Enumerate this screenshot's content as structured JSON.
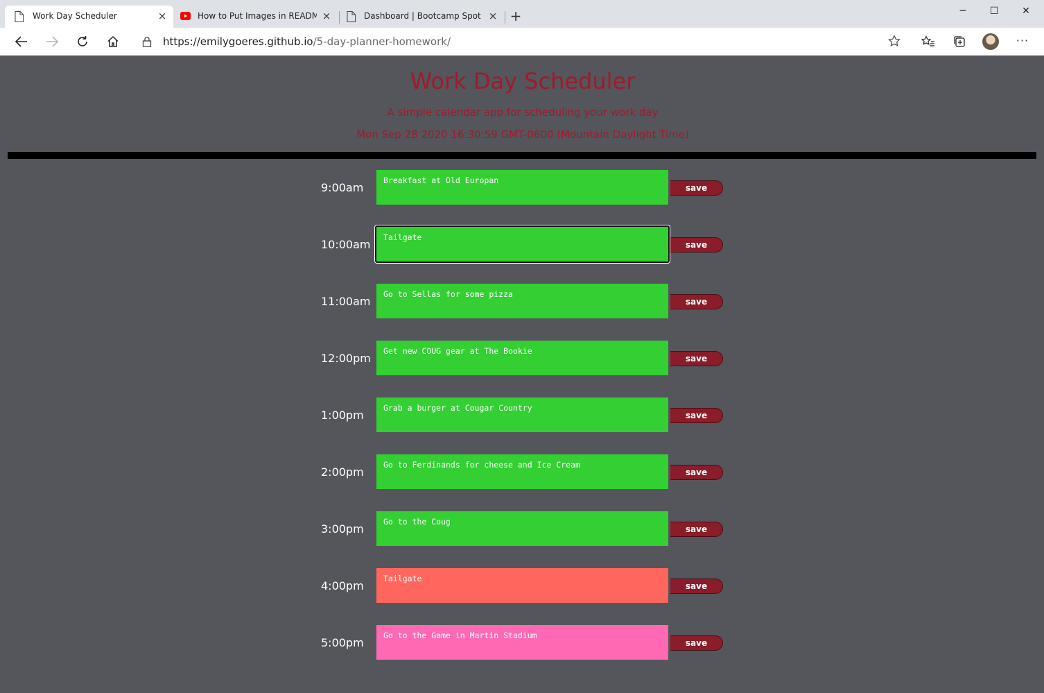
{
  "browser": {
    "tabs": [
      {
        "title": "Work Day Scheduler",
        "icon": "page-icon"
      },
      {
        "title": "How to Put Images in README f",
        "icon": "youtube-icon"
      },
      {
        "title": "Dashboard | Bootcamp Spot",
        "icon": "page-icon"
      }
    ],
    "close_glyph": "×",
    "new_tab_glyph": "+",
    "url_host": "https://emilygoeres.github.io",
    "url_path": "/5-day-planner-homework/",
    "window_controls": {
      "minimize": "─",
      "maximize": "☐",
      "close": "✕"
    },
    "more_glyph": "···"
  },
  "header": {
    "title": "Work Day Scheduler",
    "lead": "A simple calendar app for scheduling your work day",
    "current_day": "Mon Sep 28 2020 16:30:59 GMT-0600 (Mountain Daylight Time)"
  },
  "save_label": "save",
  "schedule": [
    {
      "hour": "9:00am",
      "text": "Breakfast at Old Europan",
      "status": "present"
    },
    {
      "hour": "10:00am",
      "text": "Tailgate",
      "status": "present",
      "focused": true
    },
    {
      "hour": "11:00am",
      "text": "Go to Sellas for some pizza",
      "status": "present"
    },
    {
      "hour": "12:00pm",
      "text": "Get new COUG gear at The Bookie",
      "status": "present"
    },
    {
      "hour": "1:00pm",
      "text": "Grab a burger at Cougar Country",
      "status": "present"
    },
    {
      "hour": "2:00pm",
      "text": "Go to Ferdinands for cheese and Ice Cream",
      "status": "present"
    },
    {
      "hour": "3:00pm",
      "text": "Go to the Coug",
      "status": "present"
    },
    {
      "hour": "4:00pm",
      "text": "Tailgate",
      "status": "past"
    },
    {
      "hour": "5:00pm",
      "text": "Go to the Game in Martin Stadium",
      "status": "future"
    }
  ],
  "colors": {
    "present": "#33cf33",
    "past": "#ff665e",
    "future": "#ff69b4",
    "accent": "#9e1b2e",
    "save": "#8b1c2a",
    "background": "#54565b"
  }
}
